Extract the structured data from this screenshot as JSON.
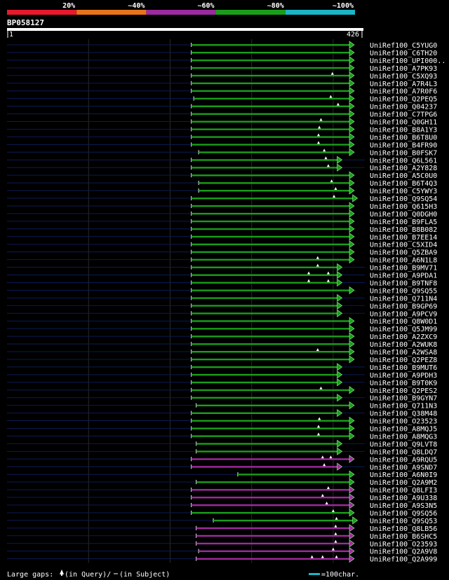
{
  "query_id": "BP058127",
  "query_range": {
    "start_label": "1",
    "end_label": "426"
  },
  "identity_legend": [
    {
      "label": "20%",
      "color": "#e8192c"
    },
    {
      "label": "~40%",
      "color": "#e8741a"
    },
    {
      "label": "~60%",
      "color": "#9b2b9e"
    },
    {
      "label": "~80%",
      "color": "#1a9e1a"
    },
    {
      "label": "~100%",
      "color": "#19b6c8"
    }
  ],
  "footer": {
    "gaps_label": "Large gaps:",
    "gaps_query": "(in Query)/",
    "gaps_subject": "(in Subject)",
    "scale_label": "=100char."
  },
  "colors": {
    "green": "#1a9e1a",
    "magenta": "#a02aa0",
    "navy": "#0c1a55",
    "grid": "#2a2a2a"
  },
  "chart_data": {
    "type": "alignment-overview",
    "x_axis": {
      "min": 1,
      "max": 426
    },
    "hits": [
      {
        "name": "UniRef100_C5YUG0",
        "start": 227,
        "end": 426,
        "color": "green",
        "query_gaps": []
      },
      {
        "name": "UniRef100_C6TH20",
        "start": 227,
        "end": 426,
        "color": "green",
        "query_gaps": []
      },
      {
        "name": "UniRef100_UPI000..",
        "start": 227,
        "end": 426,
        "color": "green",
        "query_gaps": []
      },
      {
        "name": "UniRef100_A7PK93",
        "start": 227,
        "end": 426,
        "color": "green",
        "query_gaps": []
      },
      {
        "name": "UniRef100_C5XQ93",
        "start": 227,
        "end": 426,
        "color": "green",
        "query_gaps": [
          400
        ]
      },
      {
        "name": "UniRef100_A7R4L3",
        "start": 227,
        "end": 426,
        "color": "green",
        "query_gaps": []
      },
      {
        "name": "UniRef100_A7R0F6",
        "start": 227,
        "end": 426,
        "color": "green",
        "query_gaps": []
      },
      {
        "name": "UniRef100_Q2PEQ5",
        "start": 230,
        "end": 426,
        "color": "green",
        "query_gaps": [
          398
        ]
      },
      {
        "name": "UniRef100_Q04237",
        "start": 227,
        "end": 426,
        "color": "green",
        "query_gaps": [
          407
        ]
      },
      {
        "name": "UniRef100_C7TPG6",
        "start": 227,
        "end": 426,
        "color": "green",
        "query_gaps": []
      },
      {
        "name": "UniRef100_Q0GH11",
        "start": 227,
        "end": 426,
        "color": "green",
        "query_gaps": [
          386
        ]
      },
      {
        "name": "UniRef100_B8A1Y3",
        "start": 227,
        "end": 426,
        "color": "green",
        "query_gaps": [
          384
        ]
      },
      {
        "name": "UniRef100_B6T8U0",
        "start": 227,
        "end": 426,
        "color": "green",
        "query_gaps": [
          383
        ]
      },
      {
        "name": "UniRef100_B4FR90",
        "start": 227,
        "end": 426,
        "color": "green",
        "query_gaps": [
          383
        ]
      },
      {
        "name": "UniRef100_B0FSK7",
        "start": 236,
        "end": 426,
        "color": "green",
        "query_gaps": [
          390
        ]
      },
      {
        "name": "UniRef100_Q6L561",
        "start": 227,
        "end": 411,
        "color": "green",
        "query_gaps": [
          392
        ]
      },
      {
        "name": "UniRef100_A2Y828",
        "start": 227,
        "end": 411,
        "color": "green",
        "query_gaps": [
          395
        ]
      },
      {
        "name": "UniRef100_A5C0U0",
        "start": 227,
        "end": 426,
        "color": "green",
        "query_gaps": []
      },
      {
        "name": "UniRef100_B6T4Q3",
        "start": 236,
        "end": 426,
        "color": "green",
        "query_gaps": [
          399
        ]
      },
      {
        "name": "UniRef100_C5YWY3",
        "start": 236,
        "end": 426,
        "color": "green",
        "query_gaps": [
          404
        ]
      },
      {
        "name": "UniRef100_Q9SQ54",
        "start": 227,
        "end": 430,
        "color": "green",
        "query_gaps": [
          402
        ]
      },
      {
        "name": "UniRef100_Q615H3",
        "start": 227,
        "end": 426,
        "color": "green",
        "query_gaps": []
      },
      {
        "name": "UniRef100_Q0DGH0",
        "start": 227,
        "end": 426,
        "color": "green",
        "query_gaps": []
      },
      {
        "name": "UniRef100_B9FLA5",
        "start": 227,
        "end": 426,
        "color": "green",
        "query_gaps": []
      },
      {
        "name": "UniRef100_B8B082",
        "start": 227,
        "end": 426,
        "color": "green",
        "query_gaps": []
      },
      {
        "name": "UniRef100_B7EE14",
        "start": 227,
        "end": 426,
        "color": "green",
        "query_gaps": []
      },
      {
        "name": "UniRef100_C5XID4",
        "start": 227,
        "end": 426,
        "color": "green",
        "query_gaps": []
      },
      {
        "name": "UniRef100_Q5ZBA9",
        "start": 227,
        "end": 426,
        "color": "green",
        "query_gaps": []
      },
      {
        "name": "UniRef100_A6N1L8",
        "start": 227,
        "end": 426,
        "color": "green",
        "query_gaps": [
          382
        ]
      },
      {
        "name": "UniRef100_B9MV71",
        "start": 227,
        "end": 411,
        "color": "green",
        "query_gaps": [
          382
        ]
      },
      {
        "name": "UniRef100_A9PDA1",
        "start": 227,
        "end": 411,
        "color": "green",
        "query_gaps": [
          371,
          395
        ]
      },
      {
        "name": "UniRef100_B9TNF8",
        "start": 227,
        "end": 411,
        "color": "green",
        "query_gaps": [
          371,
          395
        ]
      },
      {
        "name": "UniRef100_Q9SQ55",
        "start": 227,
        "end": 426,
        "color": "green",
        "query_gaps": []
      },
      {
        "name": "UniRef100_Q711N4",
        "start": 227,
        "end": 411,
        "color": "green",
        "query_gaps": []
      },
      {
        "name": "UniRef100_B9GP69",
        "start": 227,
        "end": 411,
        "color": "green",
        "query_gaps": []
      },
      {
        "name": "UniRef100_A9PCV9",
        "start": 227,
        "end": 411,
        "color": "green",
        "query_gaps": []
      },
      {
        "name": "UniRef100_Q8W0D1",
        "start": 227,
        "end": 426,
        "color": "green",
        "query_gaps": []
      },
      {
        "name": "UniRef100_Q5JM99",
        "start": 227,
        "end": 426,
        "color": "green",
        "query_gaps": []
      },
      {
        "name": "UniRef100_A2ZXC9",
        "start": 227,
        "end": 426,
        "color": "green",
        "query_gaps": []
      },
      {
        "name": "UniRef100_A2WUK8",
        "start": 227,
        "end": 426,
        "color": "green",
        "query_gaps": []
      },
      {
        "name": "UniRef100_A2WSA8",
        "start": 227,
        "end": 426,
        "color": "green",
        "query_gaps": [
          382
        ]
      },
      {
        "name": "UniRef100_Q2PEZ8",
        "start": 227,
        "end": 426,
        "color": "green",
        "query_gaps": []
      },
      {
        "name": "UniRef100_B9MUT6",
        "start": 227,
        "end": 411,
        "color": "green",
        "query_gaps": []
      },
      {
        "name": "UniRef100_A9PDH3",
        "start": 227,
        "end": 411,
        "color": "green",
        "query_gaps": []
      },
      {
        "name": "UniRef100_B9T0K9",
        "start": 227,
        "end": 411,
        "color": "green",
        "query_gaps": []
      },
      {
        "name": "UniRef100_Q2PES2",
        "start": 227,
        "end": 426,
        "color": "green",
        "query_gaps": [
          386
        ]
      },
      {
        "name": "UniRef100_B9GYN7",
        "start": 227,
        "end": 411,
        "color": "green",
        "query_gaps": []
      },
      {
        "name": "UniRef100_Q711N3",
        "start": 233,
        "end": 426,
        "color": "green",
        "query_gaps": []
      },
      {
        "name": "UniRef100_Q38M48",
        "start": 227,
        "end": 411,
        "color": "green",
        "query_gaps": []
      },
      {
        "name": "UniRef100_O23523",
        "start": 227,
        "end": 426,
        "color": "green",
        "query_gaps": [
          384
        ]
      },
      {
        "name": "UniRef100_A8MQJ5",
        "start": 227,
        "end": 426,
        "color": "green",
        "query_gaps": [
          383
        ]
      },
      {
        "name": "UniRef100_A8MQG3",
        "start": 227,
        "end": 426,
        "color": "green",
        "query_gaps": [
          383
        ]
      },
      {
        "name": "UniRef100_Q9LVT8",
        "start": 233,
        "end": 411,
        "color": "green",
        "query_gaps": []
      },
      {
        "name": "UniRef100_Q8LDQ7",
        "start": 233,
        "end": 411,
        "color": "green",
        "query_gaps": []
      },
      {
        "name": "UniRef100_A9RQU5",
        "start": 227,
        "end": 426,
        "color": "magenta",
        "query_gaps": [
          388,
          398
        ]
      },
      {
        "name": "UniRef100_A9SND7",
        "start": 227,
        "end": 411,
        "color": "magenta",
        "query_gaps": [
          390
        ]
      },
      {
        "name": "UniRef100_A6N0I9",
        "start": 284,
        "end": 426,
        "color": "green",
        "query_gaps": []
      },
      {
        "name": "UniRef100_Q2A9M2",
        "start": 233,
        "end": 426,
        "color": "green",
        "query_gaps": []
      },
      {
        "name": "UniRef100_Q8LFI3",
        "start": 227,
        "end": 426,
        "color": "magenta",
        "query_gaps": [
          395
        ]
      },
      {
        "name": "UniRef100_A9U338",
        "start": 227,
        "end": 426,
        "color": "magenta",
        "query_gaps": [
          388
        ]
      },
      {
        "name": "UniRef100_A9S3N5",
        "start": 227,
        "end": 426,
        "color": "magenta",
        "query_gaps": [
          393
        ]
      },
      {
        "name": "UniRef100_Q9SQ56",
        "start": 227,
        "end": 426,
        "color": "green",
        "query_gaps": [
          401
        ]
      },
      {
        "name": "UniRef100_Q9SQ53",
        "start": 254,
        "end": 430,
        "color": "green",
        "query_gaps": [
          405
        ]
      },
      {
        "name": "UniRef100_Q8LB56",
        "start": 233,
        "end": 426,
        "color": "magenta",
        "query_gaps": [
          404
        ]
      },
      {
        "name": "UniRef100_B6SHC5",
        "start": 233,
        "end": 426,
        "color": "magenta",
        "query_gaps": [
          404
        ]
      },
      {
        "name": "UniRef100_O23593",
        "start": 233,
        "end": 426,
        "color": "magenta",
        "query_gaps": [
          404
        ]
      },
      {
        "name": "UniRef100_Q2A9V8",
        "start": 236,
        "end": 426,
        "color": "magenta",
        "query_gaps": [
          401
        ]
      },
      {
        "name": "UniRef100_Q2A999",
        "start": 233,
        "end": 426,
        "color": "magenta",
        "query_gaps": [
          375,
          388,
          405
        ]
      }
    ]
  }
}
